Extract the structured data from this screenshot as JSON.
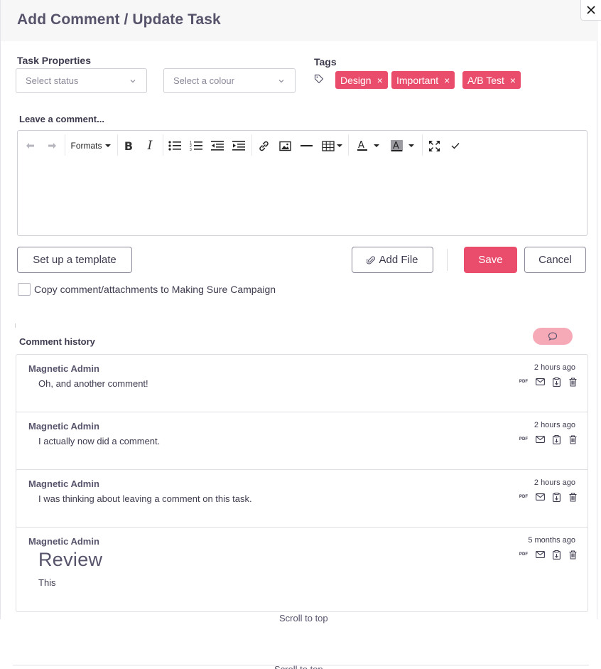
{
  "modal": {
    "title": "Add Comment / Update Task",
    "close_icon": "close-icon"
  },
  "properties": {
    "label": "Task Properties",
    "status_placeholder": "Select status",
    "colour_placeholder": "Select a colour"
  },
  "tags": {
    "label": "Tags",
    "icon": "tag-icon",
    "items": [
      {
        "label": "Design",
        "remove": "×"
      },
      {
        "label": "Important",
        "remove": "×"
      },
      {
        "label": "A/B Test",
        "remove": "×"
      }
    ]
  },
  "editor": {
    "label": "Leave a comment...",
    "formats_label": "Formats",
    "toolbar_icons": [
      "undo-icon",
      "redo-icon",
      "bold-icon",
      "italic-icon",
      "bullet-list-icon",
      "numbered-list-icon",
      "outdent-icon",
      "indent-icon",
      "link-icon",
      "image-icon",
      "horizontal-rule-icon",
      "table-icon",
      "text-color-icon",
      "background-color-icon",
      "fullscreen-icon",
      "checkmark-icon"
    ]
  },
  "actions": {
    "template_label": "Set up a template",
    "add_file_label": "Add File",
    "save_label": "Save",
    "cancel_label": "Cancel",
    "copy_label": "Copy comment/attachments to Making Sure Campaign"
  },
  "history": {
    "label": "Comment history",
    "comments": [
      {
        "author": "Magnetic Admin",
        "time": "2 hours ago",
        "text": "Oh, and another comment!"
      },
      {
        "author": "Magnetic Admin",
        "time": "2 hours ago",
        "text": "I actually now did a comment."
      },
      {
        "author": "Magnetic Admin",
        "time": "2 hours ago",
        "text": "I was thinking about leaving a comment on this task."
      },
      {
        "author": "Magnetic Admin",
        "time": "5 months ago",
        "heading": "Review",
        "text": "This"
      }
    ],
    "pdf_label": "PDF"
  },
  "footer": {
    "scroll_top": "Scroll to top",
    "scroll_top_2": "Scroll to top"
  },
  "colors": {
    "accent": "#ea4d6c",
    "pill": "#f6aab8",
    "title": "#57536b",
    "text": "#3d3a4e"
  }
}
